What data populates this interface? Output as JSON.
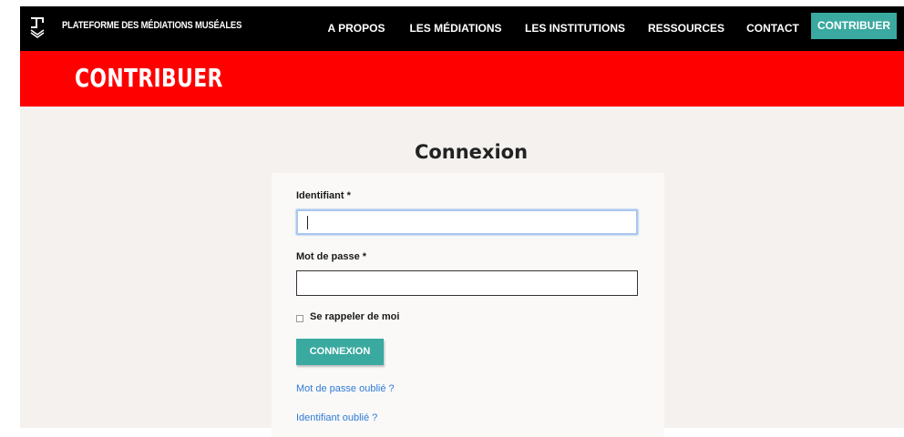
{
  "header": {
    "site_name": "PLATEFORME DES MÉDIATIONS MUSÉALES",
    "logo_icon": "stacked-chevron-logo-icon",
    "nav": [
      {
        "label": "A PROPOS"
      },
      {
        "label": "LES MÉDIATIONS"
      },
      {
        "label": "LES INSTITUTIONS"
      },
      {
        "label": "RESSOURCES"
      },
      {
        "label": "CONTACT"
      },
      {
        "label": "CONTRIBUER",
        "active": true
      }
    ]
  },
  "banner": {
    "title": "CONTRIBUER"
  },
  "login": {
    "title": "Connexion",
    "username_label": "Identifiant *",
    "username_value": "",
    "password_label": "Mot de passe *",
    "password_value": "",
    "remember_label": "Se rappeler de moi",
    "remember_checked": false,
    "submit_label": "CONNEXION",
    "forgot_password_link": "Mot de passe oublié ?",
    "forgot_username_link": "Identifiant oublié ?"
  },
  "colors": {
    "topbar": "#000000",
    "banner": "#ff0000",
    "accent": "#3aa9a0",
    "link": "#2f7bd6",
    "content_bg": "#f4f1ef"
  }
}
